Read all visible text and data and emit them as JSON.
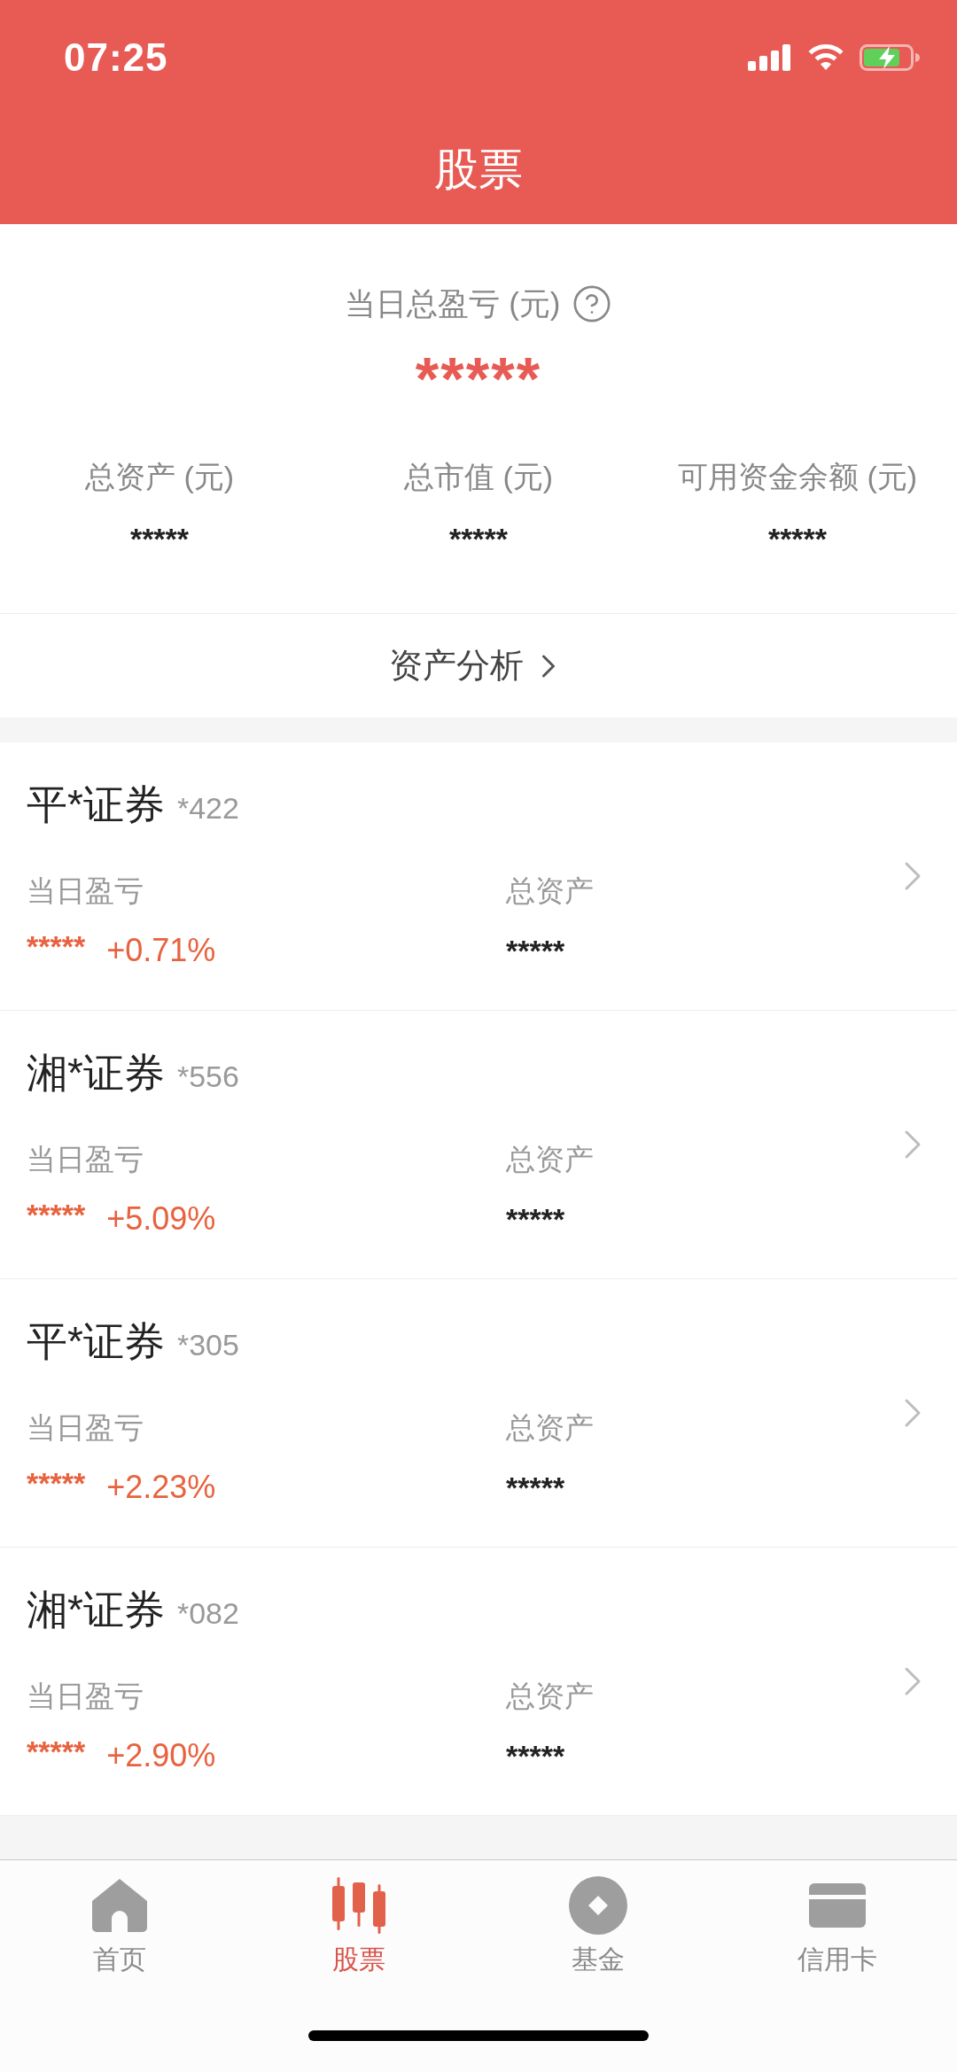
{
  "status_bar": {
    "time": "07:25"
  },
  "header": {
    "title": "股票"
  },
  "summary": {
    "label": "当日总盈亏 (元)",
    "value": "*****",
    "stats": [
      {
        "label": "总资产 (元)",
        "value": "*****"
      },
      {
        "label": "总市值 (元)",
        "value": "*****"
      },
      {
        "label": "可用资金余额 (元)",
        "value": "*****"
      }
    ]
  },
  "analysis_link": {
    "label": "资产分析"
  },
  "accounts": [
    {
      "name": "平*证券",
      "account": "*422",
      "profit_label": "当日盈亏",
      "profit": "*****",
      "change": "+0.71%",
      "assets_label": "总资产",
      "assets": "*****"
    },
    {
      "name": "湘*证券",
      "account": "*556",
      "profit_label": "当日盈亏",
      "profit": "*****",
      "change": "+5.09%",
      "assets_label": "总资产",
      "assets": "*****"
    },
    {
      "name": "平*证券",
      "account": "*305",
      "profit_label": "当日盈亏",
      "profit": "*****",
      "change": "+2.23%",
      "assets_label": "总资产",
      "assets": "*****"
    },
    {
      "name": "湘*证券",
      "account": "*082",
      "profit_label": "当日盈亏",
      "profit": "*****",
      "change": "+2.90%",
      "assets_label": "总资产",
      "assets": "*****"
    }
  ],
  "tab_bar": [
    {
      "label": "首页",
      "kind": "home",
      "selected": false
    },
    {
      "label": "股票",
      "kind": "candles",
      "selected": true
    },
    {
      "label": "基金",
      "kind": "coin",
      "selected": false
    },
    {
      "label": "信用卡",
      "kind": "card",
      "selected": false
    }
  ]
}
